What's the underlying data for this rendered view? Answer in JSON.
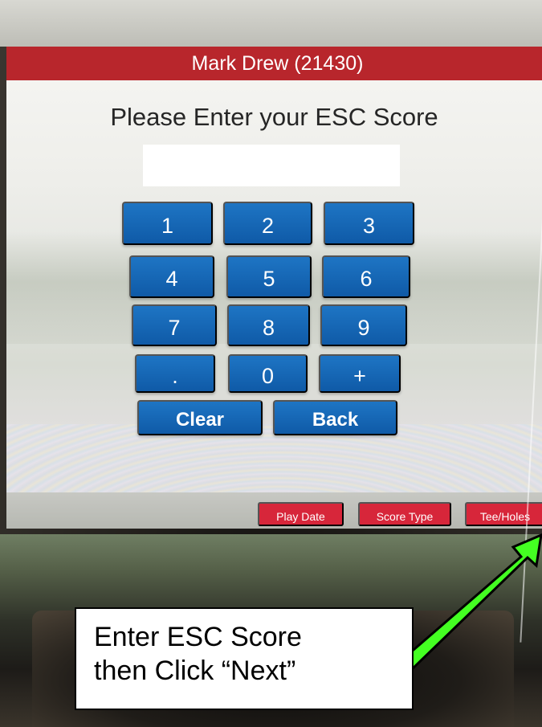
{
  "header": {
    "title": "Mark Drew (21430)"
  },
  "prompt": {
    "text": "Please Enter your ESC Score"
  },
  "score_input": {
    "value": "",
    "placeholder": ""
  },
  "keypad": {
    "digits": [
      "1",
      "2",
      "3",
      "4",
      "5",
      "6",
      "7",
      "8",
      "9",
      ".",
      "0",
      "+"
    ],
    "clear_label": "Clear",
    "back_label": "Back"
  },
  "steps": {
    "play_date": "Play Date",
    "score_type": "Score Type",
    "tee_holes": "Tee/Holes"
  },
  "callout": {
    "line1": "Enter ESC Score",
    "line2": "then Click “Next”"
  },
  "colors": {
    "header": "#b8262c",
    "key": "#1466b5",
    "step_button": "#d7263a",
    "arrow": "#44ff22"
  }
}
